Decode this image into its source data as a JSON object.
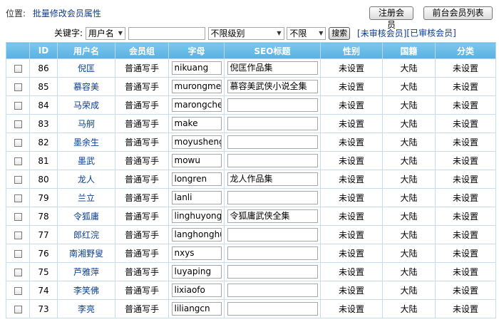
{
  "top": {
    "position_label": "位置:",
    "breadcrumb": "批量修改会员属性",
    "register_button": "注册会员",
    "front_list_button": "前台会员列表"
  },
  "filter": {
    "keyword_label": "关键字:",
    "field_select": "用户名",
    "keyword_value": "",
    "level_select": "不限级别",
    "limit_select": "不限",
    "search_button": "搜索",
    "unaudited_link": "[未审核会员]",
    "audited_link": "[已审核会员]"
  },
  "table": {
    "headers": [
      "",
      "ID",
      "用户名",
      "会员组",
      "字母",
      "SEO标题",
      "性别",
      "国籍",
      "分类"
    ],
    "rows": [
      {
        "id": "86",
        "name": "倪匡",
        "group": "普通写手",
        "letter": "nikuang",
        "seo": "倪匡作品集",
        "gender": "未设置",
        "country": "大陆",
        "category": "未设置"
      },
      {
        "id": "85",
        "name": "慕容美",
        "group": "普通写手",
        "letter": "murongmei",
        "seo": "慕容美武侠小说全集",
        "gender": "未设置",
        "country": "大陆",
        "category": "未设置"
      },
      {
        "id": "84",
        "name": "马荣成",
        "group": "普通写手",
        "letter": "marongcheng",
        "seo": "",
        "gender": "未设置",
        "country": "大陆",
        "category": "未设置"
      },
      {
        "id": "83",
        "name": "马舸",
        "group": "普通写手",
        "letter": "make",
        "seo": "",
        "gender": "未设置",
        "country": "大陆",
        "category": "未设置"
      },
      {
        "id": "82",
        "name": "墨余生",
        "group": "普通写手",
        "letter": "moyusheng",
        "seo": "",
        "gender": "未设置",
        "country": "大陆",
        "category": "未设置"
      },
      {
        "id": "81",
        "name": "墨武",
        "group": "普通写手",
        "letter": "mowu",
        "seo": "",
        "gender": "未设置",
        "country": "大陆",
        "category": "未设置"
      },
      {
        "id": "80",
        "name": "龙人",
        "group": "普通写手",
        "letter": "longren",
        "seo": "龙人作品集",
        "gender": "未设置",
        "country": "大陆",
        "category": "未设置"
      },
      {
        "id": "79",
        "name": "兰立",
        "group": "普通写手",
        "letter": "lanli",
        "seo": "",
        "gender": "未设置",
        "country": "大陆",
        "category": "未设置"
      },
      {
        "id": "78",
        "name": "令狐庸",
        "group": "普通写手",
        "letter": "linghuyong",
        "seo": "令狐庸武侠全集",
        "gender": "未设置",
        "country": "大陆",
        "category": "未设置"
      },
      {
        "id": "77",
        "name": "郎红浣",
        "group": "普通写手",
        "letter": "langhonghuan",
        "seo": "",
        "gender": "未设置",
        "country": "大陆",
        "category": "未设置"
      },
      {
        "id": "76",
        "name": "南湘野叟",
        "group": "普通写手",
        "letter": "nxys",
        "seo": "",
        "gender": "未设置",
        "country": "大陆",
        "category": "未设置"
      },
      {
        "id": "75",
        "name": "芦雅萍",
        "group": "普通写手",
        "letter": "luyaping",
        "seo": "",
        "gender": "未设置",
        "country": "大陆",
        "category": "未设置"
      },
      {
        "id": "74",
        "name": "李笑佛",
        "group": "普通写手",
        "letter": "lixiaofo",
        "seo": "",
        "gender": "未设置",
        "country": "大陆",
        "category": "未设置"
      },
      {
        "id": "73",
        "name": "李亮",
        "group": "普通写手",
        "letter": "liliangcn",
        "seo": "",
        "gender": "未设置",
        "country": "大陆",
        "category": "未设置"
      }
    ]
  }
}
